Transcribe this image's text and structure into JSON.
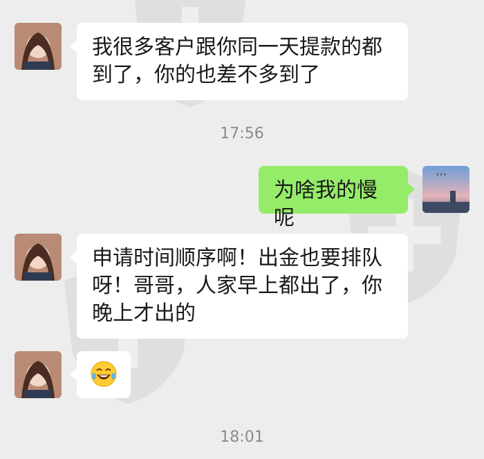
{
  "messages": [
    {
      "text": "我很多客户跟你同一天提款的都到了，你的也差不多到了"
    },
    {
      "text": "为啥我的慢呢"
    },
    {
      "text": "申请时间顺序啊！出金也要排队呀！哥哥，人家早上都出了，你晚上才出的"
    },
    {
      "emoji": "tears-of-joy"
    }
  ],
  "timestamps": [
    "17:56",
    "18:01"
  ],
  "colors": {
    "background": "#ededed",
    "incoming_bubble": "#ffffff",
    "outgoing_bubble": "#95ec69",
    "timestamp": "#8a8a8a"
  },
  "icons": [
    "contact-avatar",
    "self-avatar",
    "tears-of-joy-emoji",
    "watermark-shield-icon"
  ]
}
